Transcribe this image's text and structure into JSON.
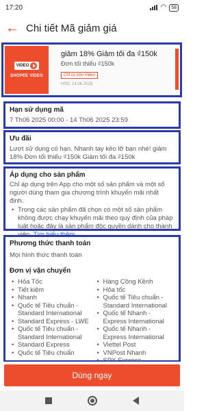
{
  "status_bar": {
    "time": "17:20",
    "battery": "58"
  },
  "header": {
    "title": "Chi tiết Mã giảm giá"
  },
  "voucher": {
    "left_label": "SHOPEE VIDEO",
    "logo_text": "VIDEO",
    "title": "giảm 18% Giảm tối đa ₫150k",
    "min_spend": "Đơn tối thiểu ₫150k",
    "tag": "Chỉ có trên Video",
    "expiry": "HSD: 14.06.2025",
    "accent_color": "#ee4d2d"
  },
  "validity": {
    "title": "Hạn sử dụng mã",
    "value": "7 Th06 2025 00:00 - 14 Th06 2025 23:59"
  },
  "offer": {
    "title": "Ưu đãi",
    "text": "Lượt sử dụng có hạn. Nhanh tay kẻo lỡ bạn nhé! giảm 18% Đơn tối thiểu ₫150k Giảm tối đa ₫150k"
  },
  "apply": {
    "title": "Áp dụng cho sản phẩm",
    "text": "Chỉ áp dụng trên App cho một số sản phẩm và một số người dùng tham gia chương trình khuyến mãi nhất định.",
    "bullet": "Trong các sản phẩm đã chọn có một số sản phẩm không được chạy khuyến mãi theo quy định của pháp luật hoặc đây là sản phẩm độc quyền dành cho thành viên.",
    "link": "Tìm hiểu thêm."
  },
  "payment": {
    "title": "Phương thức thanh toán",
    "value": "Mọi hình thức thanh toán"
  },
  "carriers": {
    "title": "Đơn vị vận chuyển",
    "left": [
      "Hỏa Tốc",
      "Tiết kiệm",
      "Nhanh",
      "Quốc tế Tiêu chuẩn - Standard International",
      "Standard Express - LWE",
      "Quốc tế Tiêu chuẩn - Standard International",
      "Standard Express",
      "Quốc tế Tiêu chuẩn"
    ],
    "right": [
      "Hàng Cồng Kềnh",
      "Hỏa tốc",
      "Quốc tế Tiêu chuẩn - Standard International",
      "Quốc tế Nhanh - Express International",
      "Quốc tế Nhanh - Express International",
      "Viettel Post",
      "VNPost Nhanh",
      "SPX Express"
    ]
  },
  "action": {
    "use_now": "Dùng ngay"
  },
  "icons": {
    "back": "back-arrow-icon",
    "signal": "signal-icon",
    "wifi": "wifi-icon",
    "battery": "battery-icon",
    "play": "play-icon",
    "nav_recents": "recents-icon",
    "nav_home": "home-icon",
    "nav_back": "nav-back-icon"
  }
}
